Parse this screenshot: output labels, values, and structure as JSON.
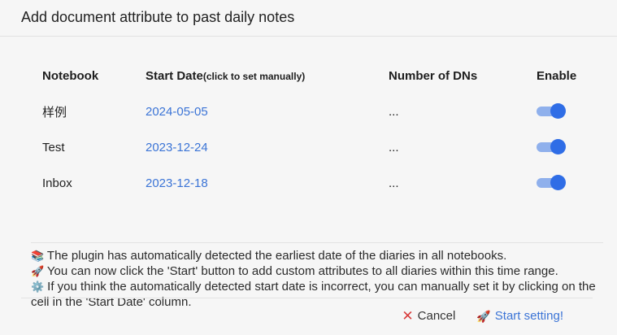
{
  "dialog": {
    "title": "Add document attribute to past daily notes"
  },
  "table": {
    "headers": {
      "notebook": "Notebook",
      "start_date": "Start Date",
      "start_date_hint": "(click to set manually)",
      "count": "Number of DNs",
      "enable": "Enable"
    },
    "rows": [
      {
        "notebook": "样例",
        "start_date": "2024-05-05",
        "count": "...",
        "enabled": true
      },
      {
        "notebook": "Test",
        "start_date": "2023-12-24",
        "count": "...",
        "enabled": true
      },
      {
        "notebook": "Inbox",
        "start_date": "2023-12-18",
        "count": "...",
        "enabled": true
      }
    ]
  },
  "info": {
    "lines": [
      {
        "icon": "books-icon",
        "glyph": "📚",
        "text": "The plugin has automatically detected the earliest date of the diaries in all notebooks."
      },
      {
        "icon": "rocket-icon",
        "glyph": "🚀",
        "text": "You can now click the 'Start' button to add custom attributes to all diaries within this time range."
      },
      {
        "icon": "gear-icon",
        "glyph": "⚙️",
        "text": "If you think the automatically detected start date is incorrect, you can manually set it by clicking on the cell in the 'Start Date' column."
      }
    ]
  },
  "footer": {
    "cancel_label": "Cancel",
    "start_label": "Start setting!"
  },
  "colors": {
    "accent": "#3b74d6",
    "toggle_on": "#2f6de6",
    "cancel_icon": "#d83b3b"
  }
}
